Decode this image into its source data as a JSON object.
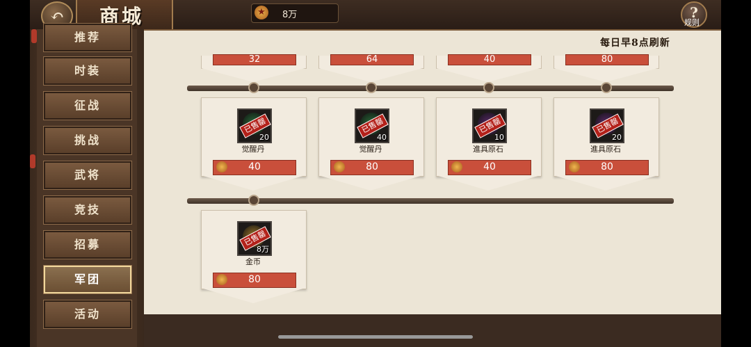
{
  "header": {
    "title": "商城",
    "back_icon": "back-arrow-icon",
    "currency": {
      "icon": "ingot-icon",
      "value": "8万"
    },
    "rules_label": "规则",
    "rules_icon": "question-icon"
  },
  "sidebar": {
    "items": [
      {
        "label": "推荐"
      },
      {
        "label": "时装"
      },
      {
        "label": "征战"
      },
      {
        "label": "挑战"
      },
      {
        "label": "武将"
      },
      {
        "label": "竞技"
      },
      {
        "label": "招募"
      },
      {
        "label": "军团",
        "active": true
      },
      {
        "label": "活动"
      }
    ]
  },
  "shop": {
    "refresh_note": "每日早8点刷新",
    "top_row_prices": [
      "32",
      "64",
      "40",
      "80"
    ],
    "row2": [
      {
        "name": "觉醒丹",
        "qty": "20",
        "price": "40",
        "sold": "已售罄",
        "art": "#2a6b3a"
      },
      {
        "name": "觉醒丹",
        "qty": "40",
        "price": "80",
        "sold": "已售罄",
        "art": "#2a6b3a"
      },
      {
        "name": "進具原石",
        "qty": "10",
        "price": "40",
        "sold": "已售罄",
        "art": "#5b2a6b"
      },
      {
        "name": "進具原石",
        "qty": "20",
        "price": "80",
        "sold": "已售罄",
        "art": "#5b2a6b"
      }
    ],
    "row3": [
      {
        "name": "金币",
        "qty": "8万",
        "price": "80",
        "sold": "已售罄",
        "art": "#a07a2a"
      }
    ]
  },
  "colors": {
    "price_bar": "#c94f3b",
    "sold_stamp": "#b3211a",
    "panel": "#ece5d6"
  }
}
